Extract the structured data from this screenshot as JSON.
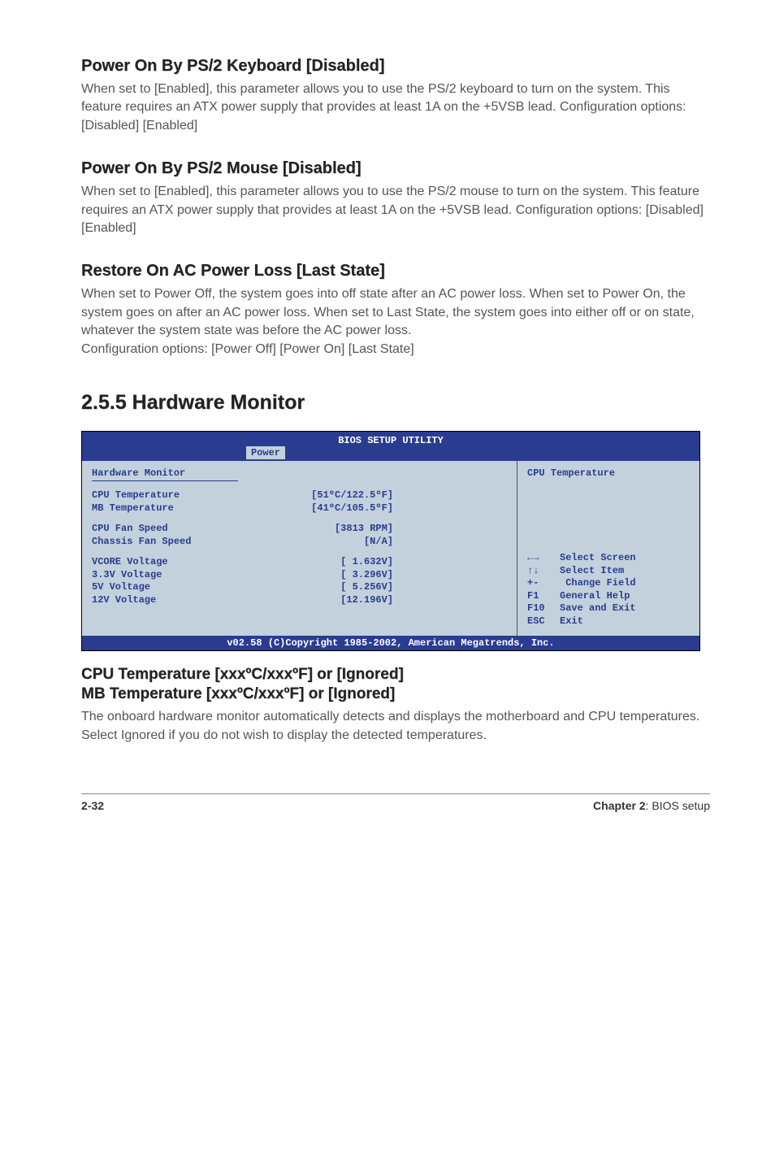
{
  "sections": {
    "ps2kb": {
      "title": "Power On By PS/2 Keyboard [Disabled]",
      "body": "When set to [Enabled], this parameter allows you to use the PS/2 keyboard to turn on the system. This feature requires an ATX power supply that provides at least 1A on the +5VSB lead. Configuration options: [Disabled] [Enabled]"
    },
    "ps2mouse": {
      "title": "Power On By PS/2 Mouse [Disabled]",
      "body": "When set to [Enabled], this parameter allows you to use the PS/2 mouse to turn on the system. This feature requires an ATX power supply that provides at least 1A on the +5VSB lead. Configuration options: [Disabled] [Enabled]"
    },
    "restore": {
      "title": "Restore On AC Power Loss [Last State]",
      "body": "When set to Power Off, the system goes into off state after an AC power loss. When set to Power On, the system goes on after an AC power loss. When set to Last State, the system goes into either off or on state, whatever the system state was before the AC power loss.\nConfiguration options: [Power Off] [Power On] [Last State]"
    },
    "hwmon": {
      "title": "2.5.5   Hardware Monitor"
    },
    "cputemp": {
      "title1": "CPU Temperature [xxxºC/xxxºF] or [Ignored]",
      "title2": "MB Temperature [xxxºC/xxxºF] or [Ignored]",
      "body": "The onboard hardware monitor automatically detects and displays the motherboard and CPU temperatures. Select Ignored if you do not wish to display the detected temperatures."
    }
  },
  "bios": {
    "header_title": "BIOS SETUP UTILITY",
    "tab": "Power",
    "panel_title": "Hardware Monitor",
    "rows": {
      "cpu_temp": {
        "label": "CPU Temperature",
        "value": "[51ºC/122.5ºF]"
      },
      "mb_temp": {
        "label": "MB Temperature",
        "value": "[41ºC/105.5ºF]"
      },
      "cpu_fan": {
        "label": "CPU Fan Speed",
        "value": "[3813 RPM]"
      },
      "chas_fan": {
        "label": "Chassis Fan Speed",
        "value": "[N/A]"
      },
      "vcore": {
        "label": "VCORE Voltage",
        "value": "[ 1.632V]"
      },
      "v33": {
        "label": "3.3V Voltage",
        "value": "[ 3.296V]"
      },
      "v5": {
        "label": "5V Voltage",
        "value": "[ 5.256V]"
      },
      "v12": {
        "label": "12V Voltage",
        "value": "[12.196V]"
      }
    },
    "help_title": "CPU Temperature",
    "hints": [
      {
        "key": "←→",
        "label": "Select Screen"
      },
      {
        "key": "↑↓",
        "label": "Select Item"
      },
      {
        "key": "+-",
        "label": " Change Field"
      },
      {
        "key": "F1",
        "label": "General Help"
      },
      {
        "key": "F10",
        "label": "Save and Exit"
      },
      {
        "key": "ESC",
        "label": "Exit"
      }
    ],
    "footer": "v02.58 (C)Copyright 1985-2002, American Megatrends, Inc."
  },
  "footer": {
    "page": "2-32",
    "chapter_label": "Chapter 2",
    "chapter_title": ": BIOS setup"
  }
}
